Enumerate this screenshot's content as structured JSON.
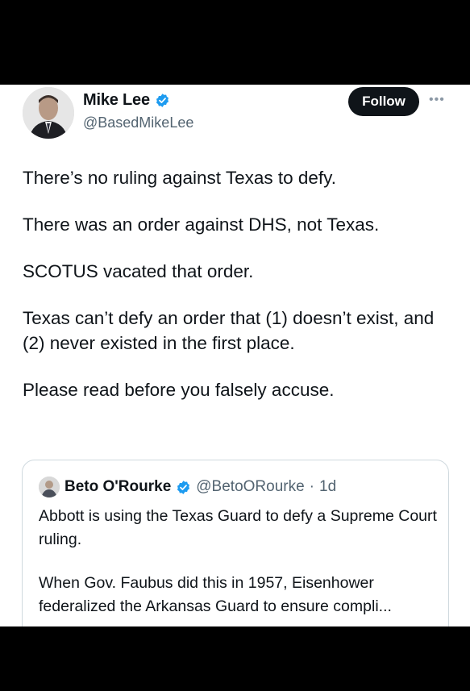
{
  "post": {
    "author_name": "Mike Lee",
    "author_handle": "@BasedMikeLee",
    "follow_label": "Follow",
    "more_label": "•••",
    "paragraphs": [
      "There’s no ruling against Texas to defy.",
      "There was an order against DHS, not Texas.",
      "SCOTUS vacated that order.",
      "Texas can’t defy an order that (1) doesn’t exist, and (2) never existed in the first place.",
      "Please read before you falsely accuse."
    ]
  },
  "quote": {
    "author_name": "Beto O'Rourke",
    "author_handle": "@BetoORourke",
    "time_sep": "·",
    "time": "1d",
    "paragraphs": [
      "Abbott is using the Texas Guard to defy a Supreme Court ruling.",
      "When Gov. Faubus did this in 1957, Eisenhower federalized the Arkansas Guard to ensure compli..."
    ]
  },
  "colors": {
    "verified": "#1d9bf0",
    "follow_bg": "#0f1419",
    "secondary_text": "#536471"
  },
  "icons": [
    "verified-badge-icon",
    "more-options-icon"
  ]
}
